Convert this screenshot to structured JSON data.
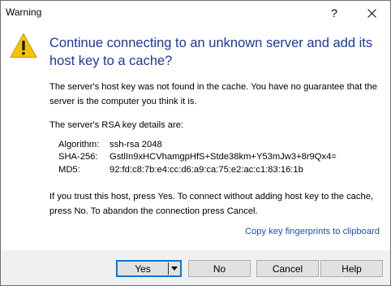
{
  "window": {
    "title": "Warning",
    "help_glyph": "?",
    "close_icon": "close-icon"
  },
  "icon": {
    "name": "warning-icon",
    "color": "#f5c400"
  },
  "heading": "Continue connecting to an unknown server and add its host key to a cache?",
  "body": {
    "paragraph1": "The server's host key was not found in the cache. You have no guarantee that the server is the computer you think it is.",
    "paragraph2": "The server's RSA key details are:",
    "details": [
      {
        "key": "Algorithm:",
        "value": "ssh-rsa 2048"
      },
      {
        "key": "SHA-256:",
        "value": "GstlIn9xHCVhamgpHfS+Stde38km+Y53mJw3+8r9Qx4="
      },
      {
        "key": "MD5:",
        "value": "92:fd:c8:7b:e4:cc:d6:a9:ca:75:e2:ac:c1:83:16:1b"
      }
    ],
    "paragraph3": "If you trust this host, press Yes. To connect without adding host key to the cache, press No. To abandon the connection press Cancel."
  },
  "copy_link": "Copy key fingerprints to clipboard",
  "buttons": {
    "yes": "Yes",
    "no": "No",
    "cancel": "Cancel",
    "help": "Help"
  },
  "colors": {
    "heading": "#17399a",
    "link": "#1a4fb5",
    "default_button_border": "#0078d7",
    "footer_bg": "#f0f0f0"
  }
}
